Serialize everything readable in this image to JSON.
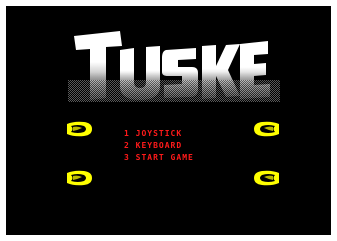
{
  "game": {
    "title": "TUSKER",
    "menu": [
      {
        "key": "1",
        "label": "JOYSTICK"
      },
      {
        "key": "2",
        "label": "KEYBOARD"
      },
      {
        "key": "3",
        "label": "START GAME"
      }
    ]
  },
  "colors": {
    "background": "#000000",
    "border": "#ffffff",
    "menu_text": "#ff1a1a",
    "tusk_fill": "#ffff00",
    "tusk_shade": "#b8b800",
    "logo_fill": "#ffffff"
  },
  "icons": {
    "corner_decor": "tusk-icon"
  }
}
